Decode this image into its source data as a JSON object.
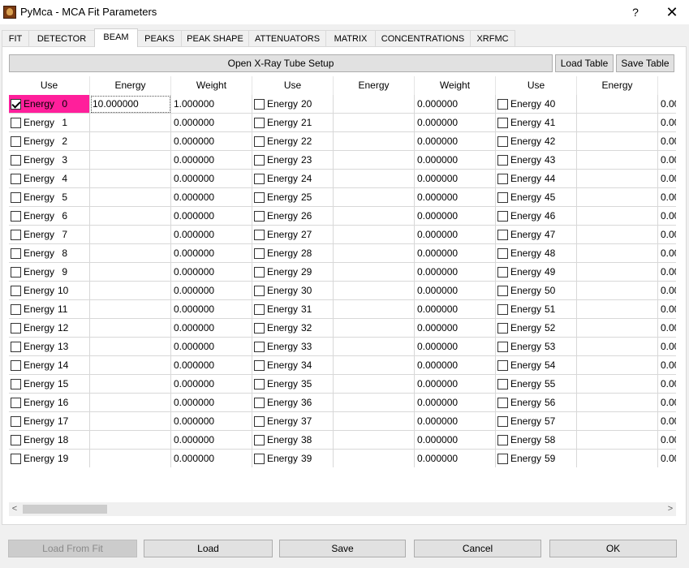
{
  "window": {
    "title": "PyMca - MCA Fit Parameters",
    "help_glyph": "?",
    "close_glyph": "✕",
    "icon": "pymca-app-icon"
  },
  "tabs": [
    {
      "label": "FIT"
    },
    {
      "label": "DETECTOR"
    },
    {
      "label": "BEAM",
      "active": true
    },
    {
      "label": "PEAKS"
    },
    {
      "label": "PEAK SHAPE"
    },
    {
      "label": "ATTENUATORS"
    },
    {
      "label": "MATRIX"
    },
    {
      "label": "CONCENTRATIONS"
    },
    {
      "label": "XRFMC"
    }
  ],
  "beam": {
    "xray_tube_button": "Open X-Ray Tube Setup",
    "load_table_button": "Load Table",
    "save_table_button": "Save Table",
    "headers": [
      "Use",
      "Energy",
      "Weight",
      "Use",
      "Energy",
      "Weight",
      "Use",
      "Energy"
    ],
    "energy_label": "Energy",
    "selected_color": "#ff1f9b",
    "rows": [
      {
        "n": "0",
        "checked": true,
        "energy": "10.000000",
        "weight": "1.000000"
      },
      {
        "n": "1",
        "checked": false,
        "energy": "",
        "weight": "0.000000"
      },
      {
        "n": "2",
        "checked": false,
        "energy": "",
        "weight": "0.000000"
      },
      {
        "n": "3",
        "checked": false,
        "energy": "",
        "weight": "0.000000"
      },
      {
        "n": "4",
        "checked": false,
        "energy": "",
        "weight": "0.000000"
      },
      {
        "n": "5",
        "checked": false,
        "energy": "",
        "weight": "0.000000"
      },
      {
        "n": "6",
        "checked": false,
        "energy": "",
        "weight": "0.000000"
      },
      {
        "n": "7",
        "checked": false,
        "energy": "",
        "weight": "0.000000"
      },
      {
        "n": "8",
        "checked": false,
        "energy": "",
        "weight": "0.000000"
      },
      {
        "n": "9",
        "checked": false,
        "energy": "",
        "weight": "0.000000"
      },
      {
        "n": "10",
        "checked": false,
        "energy": "",
        "weight": "0.000000"
      },
      {
        "n": "11",
        "checked": false,
        "energy": "",
        "weight": "0.000000"
      },
      {
        "n": "12",
        "checked": false,
        "energy": "",
        "weight": "0.000000"
      },
      {
        "n": "13",
        "checked": false,
        "energy": "",
        "weight": "0.000000"
      },
      {
        "n": "14",
        "checked": false,
        "energy": "",
        "weight": "0.000000"
      },
      {
        "n": "15",
        "checked": false,
        "energy": "",
        "weight": "0.000000"
      },
      {
        "n": "16",
        "checked": false,
        "energy": "",
        "weight": "0.000000"
      },
      {
        "n": "17",
        "checked": false,
        "energy": "",
        "weight": "0.000000"
      },
      {
        "n": "18",
        "checked": false,
        "energy": "",
        "weight": "0.000000"
      },
      {
        "n": "19",
        "checked": false,
        "energy": "",
        "weight": "0.000000"
      }
    ],
    "rows_col2": [
      {
        "n": "20",
        "weight": "0.000000"
      },
      {
        "n": "21",
        "weight": "0.000000"
      },
      {
        "n": "22",
        "weight": "0.000000"
      },
      {
        "n": "23",
        "weight": "0.000000"
      },
      {
        "n": "24",
        "weight": "0.000000"
      },
      {
        "n": "25",
        "weight": "0.000000"
      },
      {
        "n": "26",
        "weight": "0.000000"
      },
      {
        "n": "27",
        "weight": "0.000000"
      },
      {
        "n": "28",
        "weight": "0.000000"
      },
      {
        "n": "29",
        "weight": "0.000000"
      },
      {
        "n": "30",
        "weight": "0.000000"
      },
      {
        "n": "31",
        "weight": "0.000000"
      },
      {
        "n": "32",
        "weight": "0.000000"
      },
      {
        "n": "33",
        "weight": "0.000000"
      },
      {
        "n": "34",
        "weight": "0.000000"
      },
      {
        "n": "35",
        "weight": "0.000000"
      },
      {
        "n": "36",
        "weight": "0.000000"
      },
      {
        "n": "37",
        "weight": "0.000000"
      },
      {
        "n": "38",
        "weight": "0.000000"
      },
      {
        "n": "39",
        "weight": "0.000000"
      }
    ],
    "rows_col3": [
      {
        "n": "40",
        "weight": "0.00"
      },
      {
        "n": "41",
        "weight": "0.00"
      },
      {
        "n": "42",
        "weight": "0.00"
      },
      {
        "n": "43",
        "weight": "0.00"
      },
      {
        "n": "44",
        "weight": "0.00"
      },
      {
        "n": "45",
        "weight": "0.00"
      },
      {
        "n": "46",
        "weight": "0.00"
      },
      {
        "n": "47",
        "weight": "0.00"
      },
      {
        "n": "48",
        "weight": "0.00"
      },
      {
        "n": "49",
        "weight": "0.00"
      },
      {
        "n": "50",
        "weight": "0.00"
      },
      {
        "n": "51",
        "weight": "0.00"
      },
      {
        "n": "52",
        "weight": "0.00"
      },
      {
        "n": "53",
        "weight": "0.00"
      },
      {
        "n": "54",
        "weight": "0.00"
      },
      {
        "n": "55",
        "weight": "0.00"
      },
      {
        "n": "56",
        "weight": "0.00"
      },
      {
        "n": "57",
        "weight": "0.00"
      },
      {
        "n": "58",
        "weight": "0.00"
      },
      {
        "n": "59",
        "weight": "0.00"
      }
    ],
    "scroll_left": "<",
    "scroll_right": ">"
  },
  "footer": {
    "load_from_fit": "Load From Fit",
    "load": "Load",
    "save": "Save",
    "cancel": "Cancel",
    "ok": "OK"
  }
}
